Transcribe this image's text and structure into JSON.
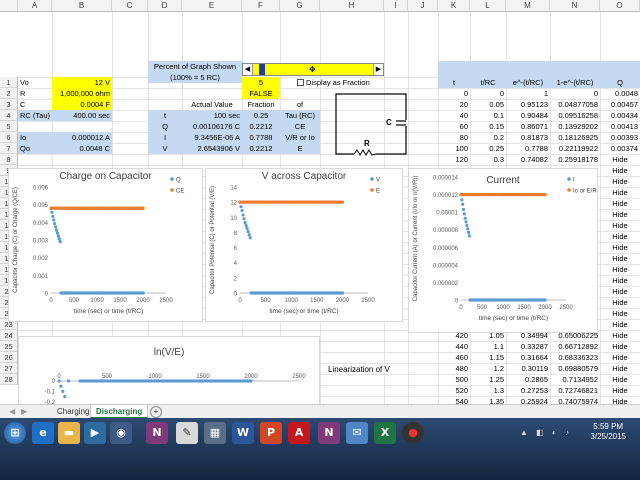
{
  "columns": [
    "A",
    "B",
    "C",
    "D",
    "E",
    "F",
    "G",
    "H",
    "I",
    "J",
    "K",
    "L",
    "M",
    "N",
    "O"
  ],
  "rows": [
    "1",
    "2",
    "3",
    "4",
    "5",
    "6",
    "7",
    "8",
    "9",
    "10",
    "11",
    "12",
    "13",
    "14",
    "15",
    "16",
    "17",
    "18",
    "19",
    "20",
    "21",
    "22",
    "23",
    "24",
    "25",
    "26",
    "27",
    "28"
  ],
  "params": {
    "vo_label": "Vo",
    "vo_value": "12 V",
    "r_label": "R",
    "r_value": "1,000,000 ohm",
    "c_label": "C",
    "c_value": "0.0004 F",
    "tau_label": "RC  (Tau)",
    "tau_value": "400.00 sec",
    "io_label": "Io",
    "io_value": "0.000012 A",
    "qo_label": "Qo",
    "qo_value": "0.0048 C"
  },
  "percent_label_1": "Percent of Graph Shown",
  "percent_label_2": "(100% = 5 RC)",
  "percent_value": "5",
  "false_value": "FALSE",
  "display_fraction_label": "Display as Fraction",
  "actual": {
    "h_actual": "Actual Value",
    "h_fraction": "Fraction",
    "h_of": "of",
    "rows": [
      {
        "sym": "t",
        "value": "100 sec",
        "frac": "0.25",
        "of": "Tau (RC)"
      },
      {
        "sym": "Q",
        "value": "0.00106176 C",
        "frac": "0.2212",
        "of": "CE"
      },
      {
        "sym": "I",
        "value": "9.3456E-06 A",
        "frac": "0.7788",
        "of": "V/R or Io"
      },
      {
        "sym": "V",
        "value": "2.6543906 V",
        "frac": "0.2212",
        "of": "E"
      }
    ]
  },
  "circuit": {
    "c": "C",
    "r": "R"
  },
  "table": {
    "headers": [
      "t",
      "t/RC",
      "e^-(t/RC)",
      "1-e^-(t/RC)",
      "Q"
    ],
    "rows": [
      [
        "0",
        "0",
        "1",
        "0",
        "0.0048"
      ],
      [
        "20",
        "0.05",
        "0.95123",
        "0.04877058",
        "0.00457"
      ],
      [
        "40",
        "0.1",
        "0.90484",
        "0.09516258",
        "0.00434"
      ],
      [
        "60",
        "0.15",
        "0.86071",
        "0.13929202",
        "0.00413"
      ],
      [
        "80",
        "0.2",
        "0.81873",
        "0.18126925",
        "0.00393"
      ],
      [
        "100",
        "0.25",
        "0.7788",
        "0.22119922",
        "0.00374"
      ],
      [
        "120",
        "0.3",
        "0.74082",
        "0.25918178",
        "Hide"
      ]
    ],
    "hide": "Hide",
    "lower_rows": [
      [
        "420",
        "1.05",
        "0.34994",
        "0.65006225",
        "Hide"
      ],
      [
        "440",
        "1.1",
        "0.33287",
        "0.66712892",
        "Hide"
      ],
      [
        "460",
        "1.15",
        "0.31664",
        "0.68336323",
        "Hide"
      ],
      [
        "480",
        "1.2",
        "0.30119",
        "0.69880579",
        "Hide"
      ],
      [
        "500",
        "1.25",
        "0.2865",
        "0.7134952",
        "Hide"
      ],
      [
        "520",
        "1.3",
        "0.27253",
        "0.72746821",
        "Hide"
      ],
      [
        "540",
        "1.35",
        "0.25924",
        "0.74075974",
        "Hide"
      ]
    ]
  },
  "linearization": "Linearization of V",
  "charts": {
    "charge": {
      "title": "Charge on Capacitor",
      "xlabel": "time (sec) or time (t/RC)",
      "ylabel": "Capacitor Charge (C) or Charge (Q/CE)",
      "legend": [
        "Q",
        "CE"
      ],
      "yticks": [
        "0",
        "0.001",
        "0.002",
        "0.003",
        "0.004",
        "0.005",
        "0.006"
      ],
      "xticks": [
        "0",
        "500",
        "1000",
        "1500",
        "2000",
        "2500"
      ]
    },
    "voltage": {
      "title": "V across Capacitor",
      "xlabel": "time (sec) or time (t/RC)",
      "ylabel": "Capacitor Potential (C) or Potential (V/E)",
      "legend": [
        "V",
        "E"
      ],
      "yticks": [
        "0",
        "2",
        "4",
        "6",
        "8",
        "10",
        "12",
        "14"
      ],
      "xticks": [
        "0",
        "500",
        "1000",
        "1500",
        "2000",
        "2500"
      ]
    },
    "current": {
      "title": "Current",
      "xlabel": "time (sec) or time (t/RC)",
      "ylabel": "Capacitor Current (A) or Current (I/Io or I/(V/R))",
      "legend": [
        "I",
        "Io or E/R"
      ],
      "yticks": [
        "0",
        "0.000002",
        "0.000004",
        "0.000006",
        "0.000008",
        "0.00001",
        "0.000012",
        "0.000014"
      ],
      "xticks": [
        "0",
        "500",
        "1000",
        "1500",
        "2000",
        "2500"
      ]
    },
    "ln": {
      "title": "ln(V/E)",
      "xticks": [
        "0",
        "500",
        "1000",
        "1500",
        "2000",
        "2500"
      ],
      "yticks": [
        "0",
        "-0.1",
        "-0.2"
      ]
    }
  },
  "chart_data": [
    {
      "type": "scatter",
      "title": "Charge on Capacitor",
      "xlabel": "time (sec) or time (t/RC)",
      "ylabel": "Capacitor Charge (C) or Charge (Q/CE)",
      "xlim": [
        0,
        2500
      ],
      "ylim": [
        0,
        0.006
      ],
      "series": [
        {
          "name": "Q",
          "color": "#5b9bd5",
          "x": [
            0,
            20,
            40,
            60,
            80,
            100,
            120,
            140,
            160,
            180,
            200,
            220,
            240,
            260,
            280,
            300,
            320,
            340,
            360,
            380,
            400,
            1000,
            1500,
            2000
          ],
          "y": [
            0.0048,
            0.00457,
            0.00434,
            0.00413,
            0.00393,
            0.00374,
            0.00356,
            0.00339,
            0.00322,
            0.00306,
            0.00291,
            0,
            0,
            0,
            0,
            0,
            0,
            0,
            0,
            0,
            0,
            0,
            0,
            0
          ]
        },
        {
          "name": "CE",
          "color": "#ed7d31",
          "x": [
            0,
            500,
            1000,
            1500,
            2000
          ],
          "y": [
            0.0048,
            0.0048,
            0.0048,
            0.0048,
            0.0048
          ]
        }
      ]
    },
    {
      "type": "scatter",
      "title": "V across Capacitor",
      "xlabel": "time (sec) or time (t/RC)",
      "ylabel": "Capacitor Potential (C) or Potential (V/E)",
      "xlim": [
        0,
        2500
      ],
      "ylim": [
        0,
        14
      ],
      "series": [
        {
          "name": "V",
          "color": "#5b9bd5",
          "x": [
            0,
            20,
            40,
            60,
            80,
            100,
            120,
            140,
            160,
            180,
            200,
            220,
            1000,
            2000
          ],
          "y": [
            12,
            11.4,
            10.9,
            10.3,
            9.8,
            9.3,
            8.9,
            8.5,
            8.1,
            7.7,
            7.3,
            0,
            0,
            0
          ]
        },
        {
          "name": "E",
          "color": "#ed7d31",
          "x": [
            0,
            500,
            1000,
            1500,
            2000
          ],
          "y": [
            12,
            12,
            12,
            12,
            12
          ]
        }
      ]
    },
    {
      "type": "scatter",
      "title": "Current",
      "xlabel": "time (sec) or time (t/RC)",
      "ylabel": "Capacitor Current (A) or Current (I/Io or I/(V/R))",
      "xlim": [
        0,
        2500
      ],
      "ylim": [
        0,
        1.4e-05
      ],
      "series": [
        {
          "name": "I",
          "color": "#5b9bd5",
          "x": [
            0,
            20,
            40,
            60,
            80,
            100,
            120,
            140,
            160,
            180,
            200,
            220,
            1000,
            2000
          ],
          "y": [
            1.2e-05,
            1.14e-05,
            1.09e-05,
            1.03e-05,
            9.8e-06,
            9.3e-06,
            8.9e-06,
            8.5e-06,
            8.1e-06,
            7.7e-06,
            7.3e-06,
            0,
            0,
            0
          ]
        },
        {
          "name": "Io or E/R",
          "color": "#ed7d31",
          "x": [
            0,
            500,
            1000,
            1500,
            2000
          ],
          "y": [
            1.2e-05,
            1.2e-05,
            1.2e-05,
            1.2e-05,
            1.2e-05
          ]
        }
      ]
    },
    {
      "type": "scatter",
      "title": "ln(V/E)",
      "xlim": [
        0,
        2500
      ],
      "ylim": [
        -0.25,
        0
      ],
      "series": [
        {
          "name": "",
          "color": "#5b9bd5",
          "x": [
            0,
            20,
            40,
            60,
            100,
            500,
            1000,
            1500,
            2000
          ],
          "y": [
            0,
            -0.05,
            -0.1,
            -0.15,
            0,
            0,
            0,
            0,
            0
          ]
        }
      ]
    }
  ],
  "tabs": {
    "charging": "Charging",
    "discharging": "Discharging",
    "add": "+"
  },
  "taskbar": {
    "time": "5:59 PM",
    "date": "3/25/2015"
  },
  "colors": {
    "yellow": "#ffff00",
    "blue": "#c5d9f1",
    "series1": "#5b9bd5",
    "series2": "#ed7d31"
  }
}
